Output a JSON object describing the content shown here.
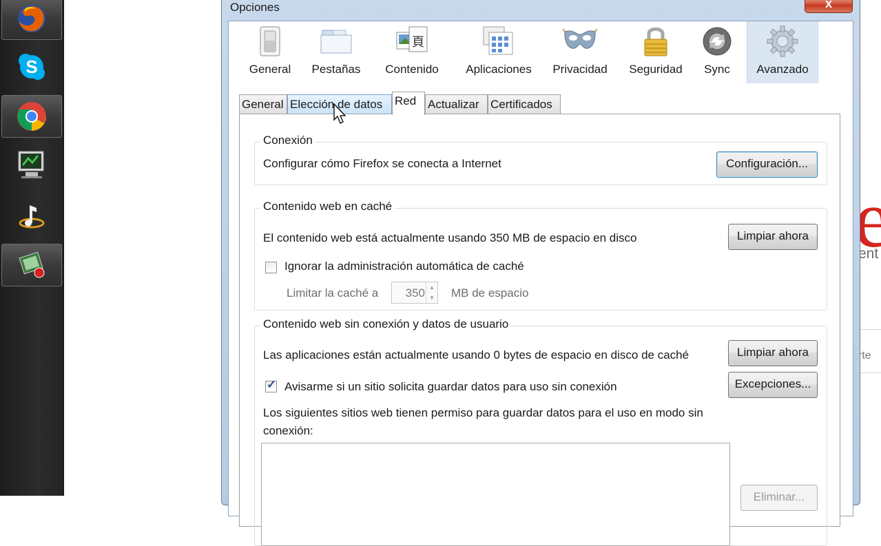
{
  "taskbar": {
    "items": [
      {
        "name": "firefox-icon",
        "active": true
      },
      {
        "name": "skype-icon",
        "active": false
      },
      {
        "name": "chrome-icon",
        "active": true
      },
      {
        "name": "remote-desktop-icon",
        "active": false
      },
      {
        "name": "music-player-icon",
        "active": false
      },
      {
        "name": "screen-recorder-icon",
        "active": true
      }
    ]
  },
  "background_app": {
    "text1": "ent",
    "text2": "rte"
  },
  "window": {
    "title": "Opciones",
    "close_glyph": "x"
  },
  "categories": [
    {
      "label": "General",
      "icon": "switch-icon"
    },
    {
      "label": "Pestañas",
      "icon": "tabs-icon"
    },
    {
      "label": "Contenido",
      "icon": "content-icon"
    },
    {
      "label": "Aplicaciones",
      "icon": "applications-icon"
    },
    {
      "label": "Privacidad",
      "icon": "mask-icon"
    },
    {
      "label": "Seguridad",
      "icon": "padlock-icon"
    },
    {
      "label": "Sync",
      "icon": "sync-icon"
    },
    {
      "label": "Avanzado",
      "icon": "gear-icon",
      "selected": true
    }
  ],
  "subtabs": [
    {
      "label": "General"
    },
    {
      "label": "Elección de datos",
      "hover": true
    },
    {
      "label": "Red",
      "active": true
    },
    {
      "label": "Actualizar"
    },
    {
      "label": "Certificados"
    }
  ],
  "conexion": {
    "title": "Conexión",
    "text": "Configurar cómo Firefox se conecta a Internet",
    "button": "Configuración..."
  },
  "cache": {
    "title": "Contenido web en caché",
    "text": "El contenido web está actualmente usando 350 MB de espacio en disco",
    "button": "Limpiar ahora",
    "override_label": "Ignorar la administración automática de caché",
    "override_checked": false,
    "limit_label": "Limitar la caché a",
    "limit_value": "350",
    "limit_unit": "MB de espacio"
  },
  "offline": {
    "title": "Contenido web sin conexión y datos de usuario",
    "text": "Las aplicaciones están actualmente usando 0 bytes de espacio en disco de caché",
    "clear_button": "Limpiar ahora",
    "warn_label": "Avisarme si un sitio solicita guardar datos para uso sin conexión",
    "warn_checked": true,
    "exceptions_button": "Excepciones...",
    "list_text_line1": "Los siguientes sitios web tienen permiso para guardar datos para el uso en modo sin",
    "list_text_line2": "conexión:",
    "remove_button": "Eliminar..."
  }
}
